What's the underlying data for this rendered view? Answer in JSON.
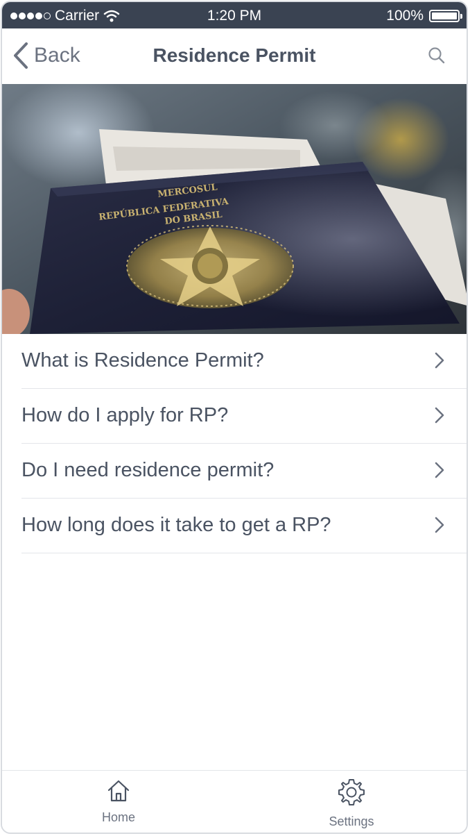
{
  "status_bar": {
    "carrier": "Carrier",
    "time": "1:20 PM",
    "battery": "100%",
    "signal_bars_filled": 4,
    "signal_bars_total": 5
  },
  "nav": {
    "back_label": "Back",
    "title": "Residence Permit",
    "search_icon": "search-icon"
  },
  "hero": {
    "cover_text_line1": "MERCOSUL",
    "cover_text_line2": "REPÚBLICA FEDERATIVA",
    "cover_text_line3": "DO BRASIL"
  },
  "faq": {
    "items": [
      {
        "label": "What is Residence Permit?"
      },
      {
        "label": "How do I apply for RP?"
      },
      {
        "label": "Do I need residence permit?"
      },
      {
        "label": "How long does it take to get a RP?"
      }
    ]
  },
  "tab_bar": {
    "home_label": "Home",
    "settings_label": "Settings"
  },
  "colors": {
    "status_bar_bg": "#3a4352",
    "text": "#4a5362",
    "accent_gray": "#6b7280",
    "separator": "#e3e5e9"
  }
}
